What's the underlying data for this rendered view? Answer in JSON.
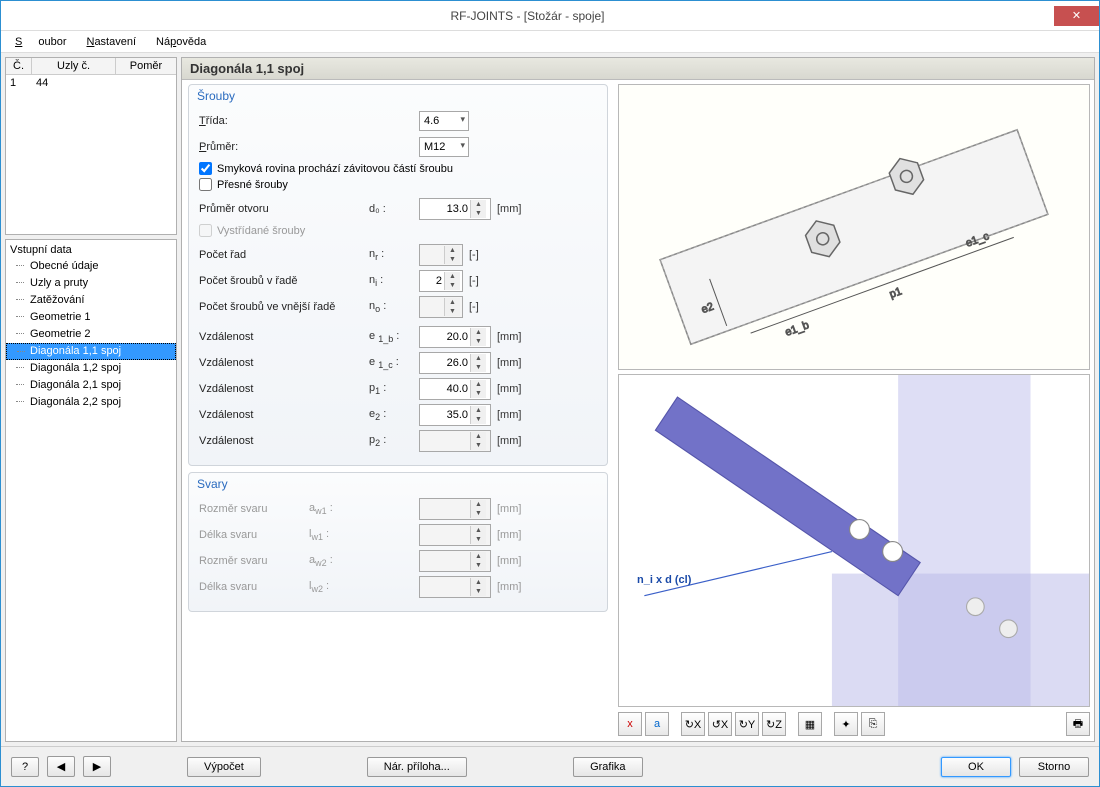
{
  "title": "RF-JOINTS - [Stožár - spoje]",
  "menu": {
    "file": "Soubor",
    "settings": "Nastavení",
    "help": "Nápověda"
  },
  "list": {
    "hdr_c": "Č.",
    "hdr_uzly": "Uzly č.",
    "hdr_pomer": "Poměr",
    "rows": [
      {
        "c": "1",
        "uzly": "44",
        "pomer": ""
      }
    ]
  },
  "tree": {
    "title": "Vstupní data",
    "items": [
      "Obecné údaje",
      "Uzly a pruty",
      "Zatěžování",
      "Geometrie 1",
      "Geometrie 2",
      "Diagonála 1,1 spoj",
      "Diagonála 1,2 spoj",
      "Diagonála 2,1 spoj",
      "Diagonála 2,2 spoj"
    ],
    "selected": 5
  },
  "panel_title": "Diagonála 1,1 spoj",
  "bolts": {
    "legend": "Šrouby",
    "class_label": "Třída:",
    "class_val": "4.6",
    "dia_label": "Průměr:",
    "dia_val": "M12",
    "shear_plane": "Smyková rovina prochází závitovou částí šroubu",
    "precise": "Přesné šrouby",
    "hole_dia": "Průměr otvoru",
    "hole_sym": "d₀ :",
    "hole_val": "13.0",
    "hole_unit": "[mm]",
    "staggered": "Vystřídané šrouby",
    "rows_label": "Počet řad",
    "rows_sym": "nr :",
    "rows_unit": "[-]",
    "perrow_label": "Počet šroubů v řadě",
    "perrow_sym": "ni :",
    "perrow_val": "2",
    "perrow_unit": "[-]",
    "outer_label": "Počet šroubů ve vnější řadě",
    "outer_sym": "no :",
    "outer_unit": "[-]",
    "d1_label": "Vzdálenost",
    "d1_sym": "e 1_b :",
    "d1_val": "20.0",
    "d1_unit": "[mm]",
    "d2_label": "Vzdálenost",
    "d2_sym": "e 1_c :",
    "d2_val": "26.0",
    "d2_unit": "[mm]",
    "d3_label": "Vzdálenost",
    "d3_sym": "p1 :",
    "d3_val": "40.0",
    "d3_unit": "[mm]",
    "d4_label": "Vzdálenost",
    "d4_sym": "e2 :",
    "d4_val": "35.0",
    "d4_unit": "[mm]",
    "d5_label": "Vzdálenost",
    "d5_sym": "p2 :",
    "d5_unit": "[mm]"
  },
  "welds": {
    "legend": "Svary",
    "r1": "Rozměr svaru",
    "s1": "aw1 :",
    "u1": "[mm]",
    "r2": "Délka svaru",
    "s2": "lw1 :",
    "u2": "[mm]",
    "r3": "Rozměr svaru",
    "s3": "aw2 :",
    "u3": "[mm]",
    "r4": "Délka svaru",
    "s4": "lw2 :",
    "u4": "[mm]"
  },
  "preview_label": "n_i x d (cl)",
  "footer": {
    "calc": "Výpočet",
    "nat": "Nár. příloha...",
    "graph": "Grafika",
    "ok": "OK",
    "cancel": "Storno"
  }
}
